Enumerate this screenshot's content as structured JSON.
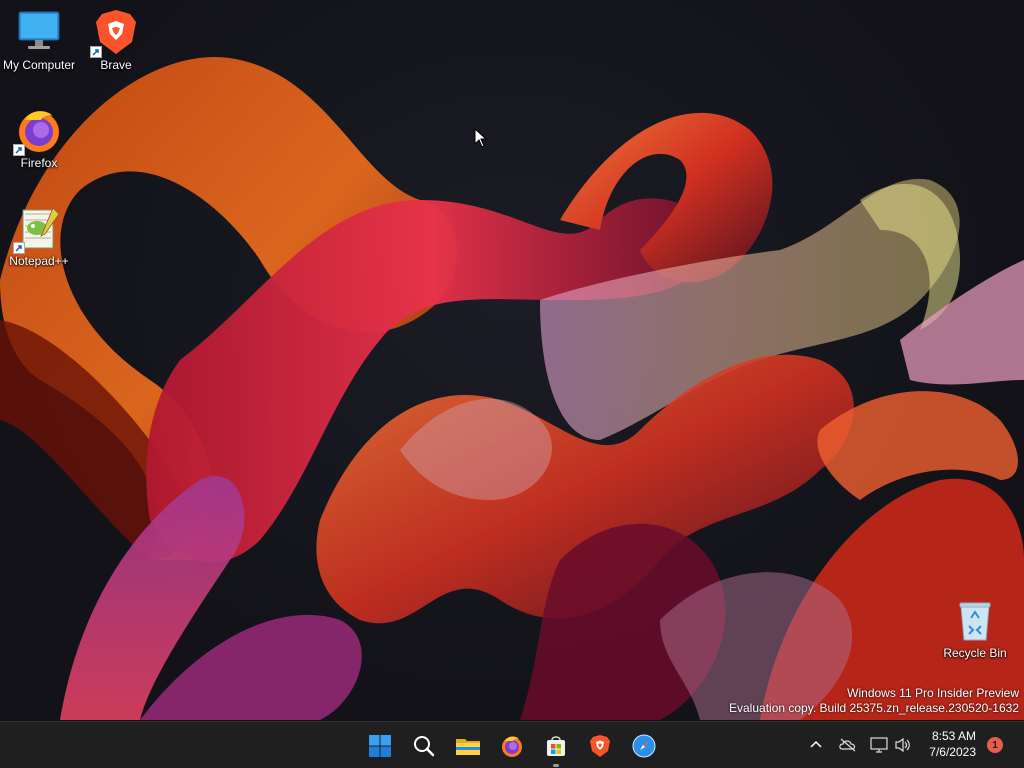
{
  "desktop": {
    "icons": [
      {
        "label": "My Computer",
        "icon": "monitor-icon"
      },
      {
        "label": "Brave",
        "icon": "brave-icon"
      },
      {
        "label": "Firefox",
        "icon": "firefox-icon"
      },
      {
        "label": "Notepad++",
        "icon": "notepadpp-icon"
      },
      {
        "label": "Recycle Bin",
        "icon": "recycle-bin-icon"
      }
    ],
    "watermark": {
      "line1": "Windows 11 Pro Insider Preview",
      "line2": "Evaluation copy. Build 25375.zn_release.230520-1632"
    }
  },
  "taskbar": {
    "apps": [
      {
        "name": "Start",
        "icon": "windows-logo-icon"
      },
      {
        "name": "Search",
        "icon": "search-icon"
      },
      {
        "name": "File Explorer",
        "icon": "folder-icon"
      },
      {
        "name": "Firefox",
        "icon": "firefox-icon"
      },
      {
        "name": "Microsoft Store",
        "icon": "store-icon",
        "running": true
      },
      {
        "name": "Brave",
        "icon": "brave-icon"
      },
      {
        "name": "Safari-like browser",
        "icon": "compass-icon"
      }
    ],
    "tray": {
      "icons": [
        "chevron-up-icon",
        "network-off-icon",
        "display-icon",
        "volume-icon"
      ]
    },
    "clock": {
      "time": "8:53 AM",
      "date": "7/6/2023"
    },
    "notifications": {
      "count": "1"
    }
  },
  "colors": {
    "taskbar_bg": "#1f1f1f",
    "accent": "#0078d4",
    "notification_badge": "#e85d4a"
  }
}
